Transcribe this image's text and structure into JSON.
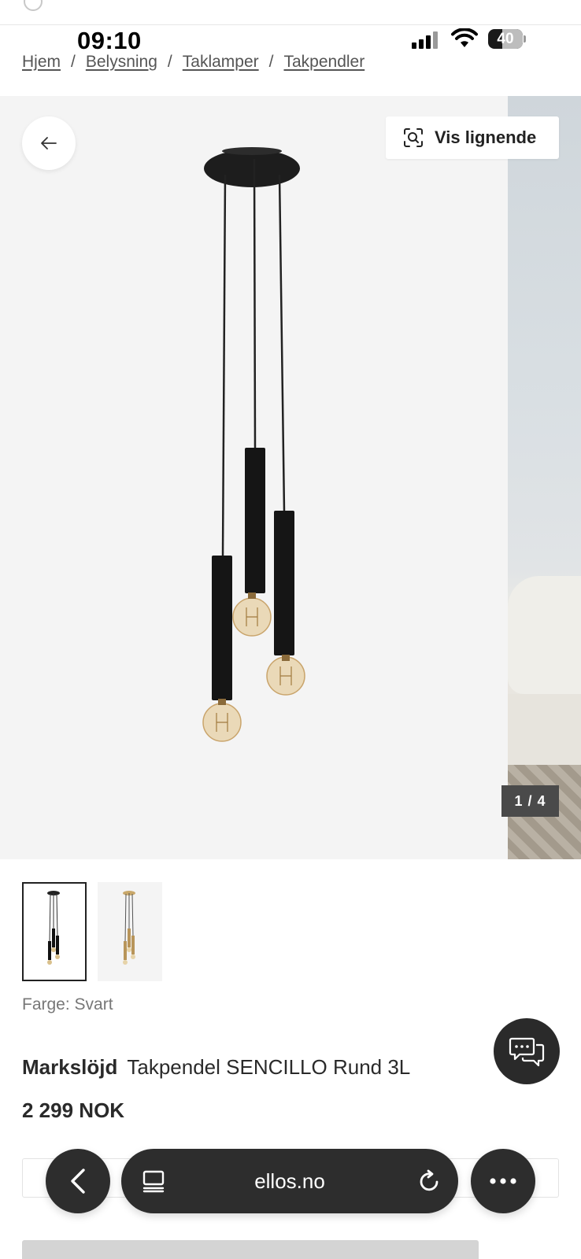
{
  "status_bar": {
    "time": "09:10",
    "battery": "40",
    "battery_level": 0.4
  },
  "breadcrumb": [
    {
      "label": "Hjem"
    },
    {
      "label": "Belysning"
    },
    {
      "label": "Taklamper"
    },
    {
      "label": "Takpendler"
    }
  ],
  "breadcrumb_separator": "/",
  "gallery": {
    "similar_button": "Vis lignende",
    "counter": "1 / 4"
  },
  "color_label": "Farge: Svart",
  "product": {
    "brand": "Markslöjd",
    "name": "Takpendel SENCILLO Rund 3L",
    "price": "2 299 NOK"
  },
  "browser": {
    "url": "ellos.no"
  },
  "colors": {
    "dark_control": "#2d2d2d",
    "counter_bg": "#4a4a4a",
    "gallery_bg": "#f4f4f4"
  }
}
